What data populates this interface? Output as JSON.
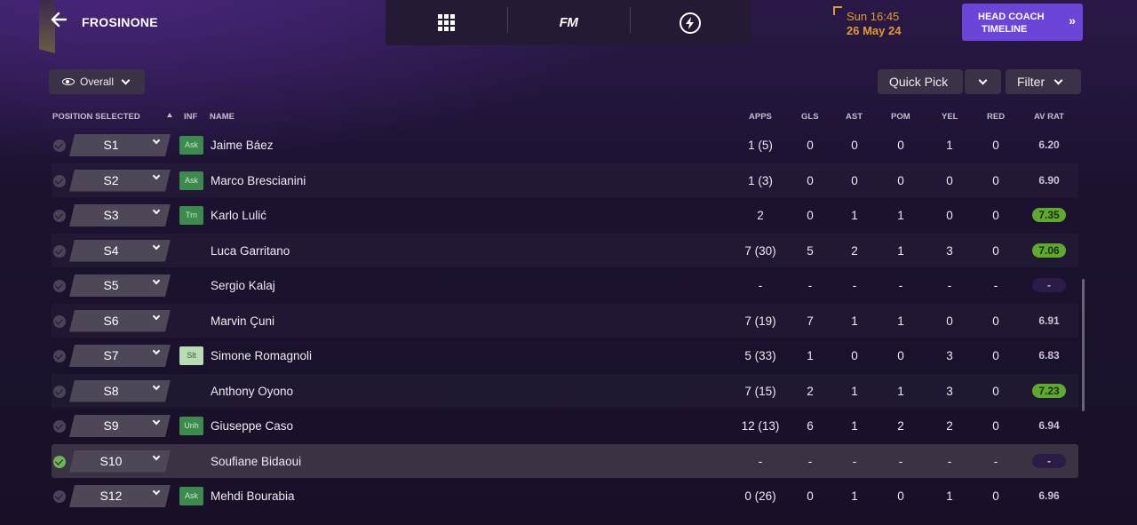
{
  "header": {
    "club_name": "FROSINONE",
    "date_time": "Sun 16:45",
    "date_day": "26 May 24",
    "coach_button_line1": "HEAD COACH",
    "coach_button_line2": "TIMELINE",
    "nav_logo": "FM",
    "icons": [
      "back-arrow-icon",
      "grid-menu-icon",
      "lightning-bolt-icon",
      "double-chevron-right-icon"
    ]
  },
  "controls": {
    "overall": "Overall",
    "quick_pick": "Quick Pick",
    "filter": "Filter"
  },
  "columns": {
    "position": "POSITION SELECTED",
    "inf": "INF",
    "name": "NAME",
    "apps": "APPS",
    "gls": "GLS",
    "ast": "AST",
    "pom": "POM",
    "yel": "YEL",
    "red": "RED",
    "avrat": "AV RAT"
  },
  "colors": {
    "rating_high": "#5eaa2e",
    "accent_purple": "#6b44d8",
    "date_orange": "#e19b2e",
    "selected_check": "#6fb25a"
  },
  "players": [
    {
      "pos": "S1",
      "inf": "Ask",
      "name": "Jaime Báez",
      "apps": "1 (5)",
      "gls": "0",
      "ast": "0",
      "pom": "0",
      "yel": "1",
      "red": "0",
      "rat": "6.20",
      "rat_style": "plain"
    },
    {
      "pos": "S2",
      "inf": "Ask",
      "name": "Marco Brescianini",
      "apps": "1 (3)",
      "gls": "0",
      "ast": "0",
      "pom": "0",
      "yel": "0",
      "red": "0",
      "rat": "6.90",
      "rat_style": "plain"
    },
    {
      "pos": "S3",
      "inf": "Trn",
      "name": "Karlo Lulić",
      "apps": "2",
      "gls": "0",
      "ast": "1",
      "pom": "1",
      "yel": "0",
      "red": "0",
      "rat": "7.35",
      "rat_style": "hi"
    },
    {
      "pos": "S4",
      "inf": "",
      "name": "Luca Garritano",
      "apps": "7 (30)",
      "gls": "5",
      "ast": "2",
      "pom": "1",
      "yel": "3",
      "red": "0",
      "rat": "7.06",
      "rat_style": "hi"
    },
    {
      "pos": "S5",
      "inf": "",
      "name": "Sergio Kalaj",
      "apps": "-",
      "gls": "-",
      "ast": "-",
      "pom": "-",
      "yel": "-",
      "red": "-",
      "rat": "-",
      "rat_style": "none"
    },
    {
      "pos": "S6",
      "inf": "",
      "name": "Marvin Çuni",
      "apps": "7 (19)",
      "gls": "7",
      "ast": "1",
      "pom": "1",
      "yel": "0",
      "red": "0",
      "rat": "6.91",
      "rat_style": "plain"
    },
    {
      "pos": "S7",
      "inf": "Slt",
      "name": "Simone Romagnoli",
      "apps": "5 (33)",
      "gls": "1",
      "ast": "0",
      "pom": "0",
      "yel": "3",
      "red": "0",
      "rat": "6.83",
      "rat_style": "plain"
    },
    {
      "pos": "S8",
      "inf": "",
      "name": "Anthony Oyono",
      "apps": "7 (15)",
      "gls": "2",
      "ast": "1",
      "pom": "1",
      "yel": "3",
      "red": "0",
      "rat": "7.23",
      "rat_style": "hi"
    },
    {
      "pos": "S9",
      "inf": "Unh",
      "name": "Giuseppe Caso",
      "apps": "12 (13)",
      "gls": "6",
      "ast": "1",
      "pom": "2",
      "yel": "2",
      "red": "0",
      "rat": "6.94",
      "rat_style": "plain"
    },
    {
      "pos": "S10",
      "inf": "",
      "name": "Soufiane Bidaoui",
      "apps": "-",
      "gls": "-",
      "ast": "-",
      "pom": "-",
      "yel": "-",
      "red": "-",
      "rat": "-",
      "rat_style": "none",
      "selected": true
    },
    {
      "pos": "S12",
      "inf": "Ask",
      "name": "Mehdi Bourabia",
      "apps": "0 (26)",
      "gls": "0",
      "ast": "1",
      "pom": "0",
      "yel": "1",
      "red": "0",
      "rat": "6.96",
      "rat_style": "plain"
    }
  ]
}
